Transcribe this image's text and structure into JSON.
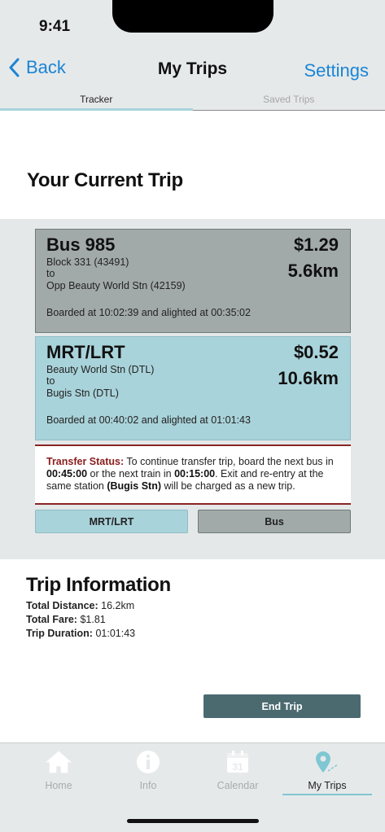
{
  "status": {
    "time": "9:41"
  },
  "nav": {
    "back_label": "Back",
    "title": "My Trips",
    "settings_label": "Settings"
  },
  "tabs": [
    {
      "label": "Tracker",
      "active": true
    },
    {
      "label": "Saved Trips",
      "active": false
    }
  ],
  "current_trip": {
    "heading": "Your Current Trip",
    "legs": [
      {
        "name": "Bus 985",
        "fare": "$1.29",
        "distance": "5.6km",
        "from": "Block 331 (43491)",
        "to_word": "to",
        "to": "Opp Beauty World Stn (42159)",
        "times": "Boarded at 10:02:39 and alighted at 00:35:02"
      },
      {
        "name": "MRT/LRT",
        "fare": "$0.52",
        "distance": "10.6km",
        "from": "Beauty World Stn (DTL)",
        "to_word": "to",
        "to": "Bugis Stn (DTL)",
        "times": "Boarded at 00:40:02 and alighted at 01:01:43"
      }
    ],
    "transfer": {
      "label": "Transfer Status:",
      "text_1": " To continue transfer trip, board the next bus in ",
      "bus_time": "00:45:00",
      "text_2": " or the next train in ",
      "train_time": "00:15:00",
      "text_3": ". Exit and re-entry at the same station ",
      "station": "(Bugis Stn)",
      "text_4": " will be charged as a new trip."
    },
    "mode_buttons": {
      "mrt": "MRT/LRT",
      "bus": "Bus"
    }
  },
  "trip_info": {
    "heading": "Trip Information",
    "total_distance_label": "Total Distance:",
    "total_distance": "16.2km",
    "total_fare_label": "Total Fare:",
    "total_fare": "$1.81",
    "trip_duration_label": "Trip Duration:",
    "trip_duration": "01:01:43"
  },
  "end_trip_label": "End Trip",
  "tabbar": {
    "items": [
      {
        "label": "Home",
        "icon": "home-icon"
      },
      {
        "label": "Info",
        "icon": "info-icon"
      },
      {
        "label": "Calendar",
        "icon": "calendar-icon",
        "day": "31"
      },
      {
        "label": "My Trips",
        "icon": "map-pin-icon",
        "active": true
      }
    ]
  },
  "colors": {
    "accent_blue": "#1a85d6",
    "bus_leg": "#a2aaa9",
    "mrt_leg": "#a9d3da",
    "transfer_red": "#8a1c1c",
    "end_button": "#4b6a70"
  }
}
